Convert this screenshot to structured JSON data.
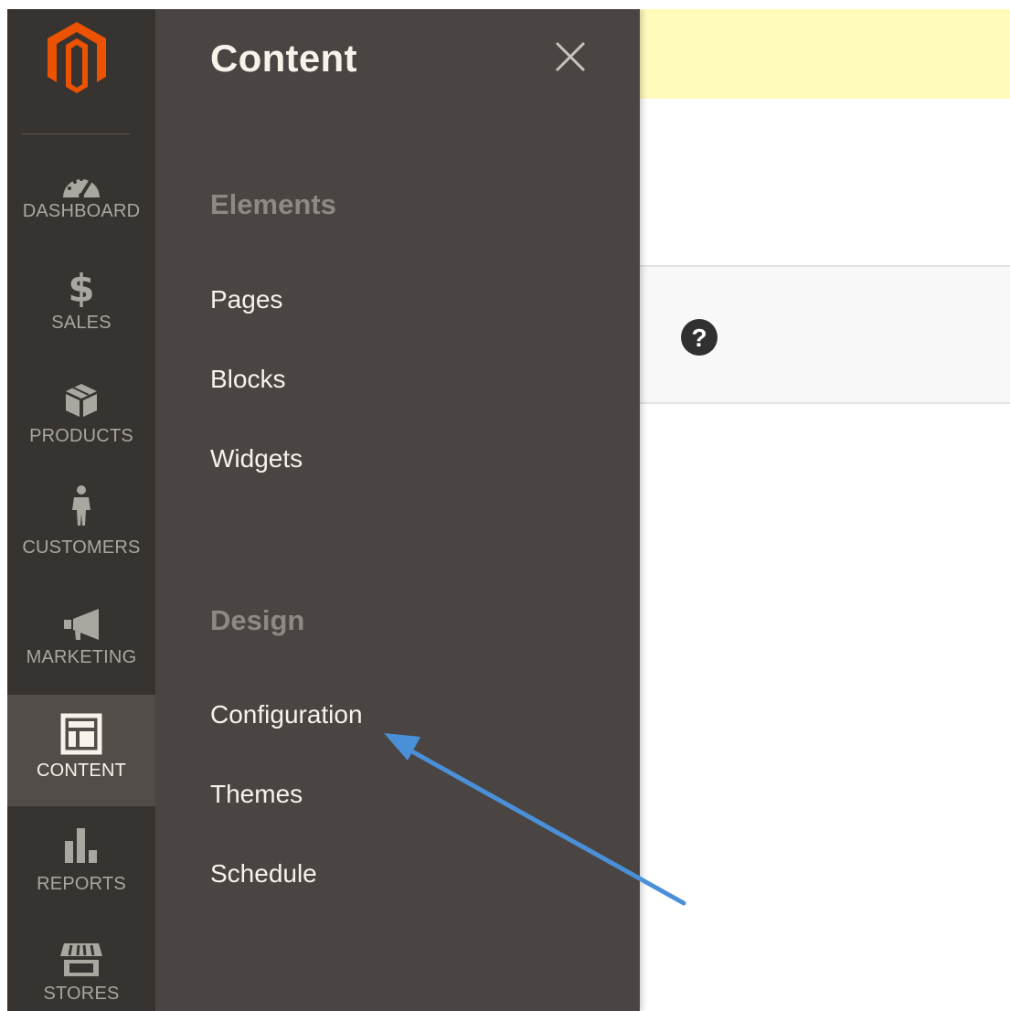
{
  "nav": {
    "items": [
      {
        "id": "dashboard",
        "label": "DASHBOARD",
        "icon": "dashboard-icon",
        "active": false
      },
      {
        "id": "sales",
        "label": "SALES",
        "icon": "dollar-icon",
        "active": false
      },
      {
        "id": "products",
        "label": "PRODUCTS",
        "icon": "box-icon",
        "active": false
      },
      {
        "id": "customers",
        "label": "CUSTOMERS",
        "icon": "person-icon",
        "active": false
      },
      {
        "id": "marketing",
        "label": "MARKETING",
        "icon": "megaphone-icon",
        "active": false
      },
      {
        "id": "content",
        "label": "CONTENT",
        "icon": "layout-icon",
        "active": true
      },
      {
        "id": "reports",
        "label": "REPORTS",
        "icon": "bar-chart-icon",
        "active": false
      },
      {
        "id": "stores",
        "label": "STORES",
        "icon": "storefront-icon",
        "active": false
      }
    ]
  },
  "flyout": {
    "title": "Content",
    "sections": [
      {
        "title": "Elements",
        "links": [
          "Pages",
          "Blocks",
          "Widgets"
        ]
      },
      {
        "title": "Design",
        "links": [
          "Configuration",
          "Themes",
          "Schedule"
        ]
      }
    ]
  },
  "colors": {
    "nav_bg": "#373330",
    "nav_active_bg": "#524d49",
    "flyout_bg": "#4a4542",
    "logo_orange": "#eb5202",
    "notice_bg": "#fffbbb",
    "arrow_blue": "#4a90d9"
  },
  "icons": {
    "logo": "magento-logo-icon",
    "close": "close-icon",
    "help": "help-icon"
  }
}
